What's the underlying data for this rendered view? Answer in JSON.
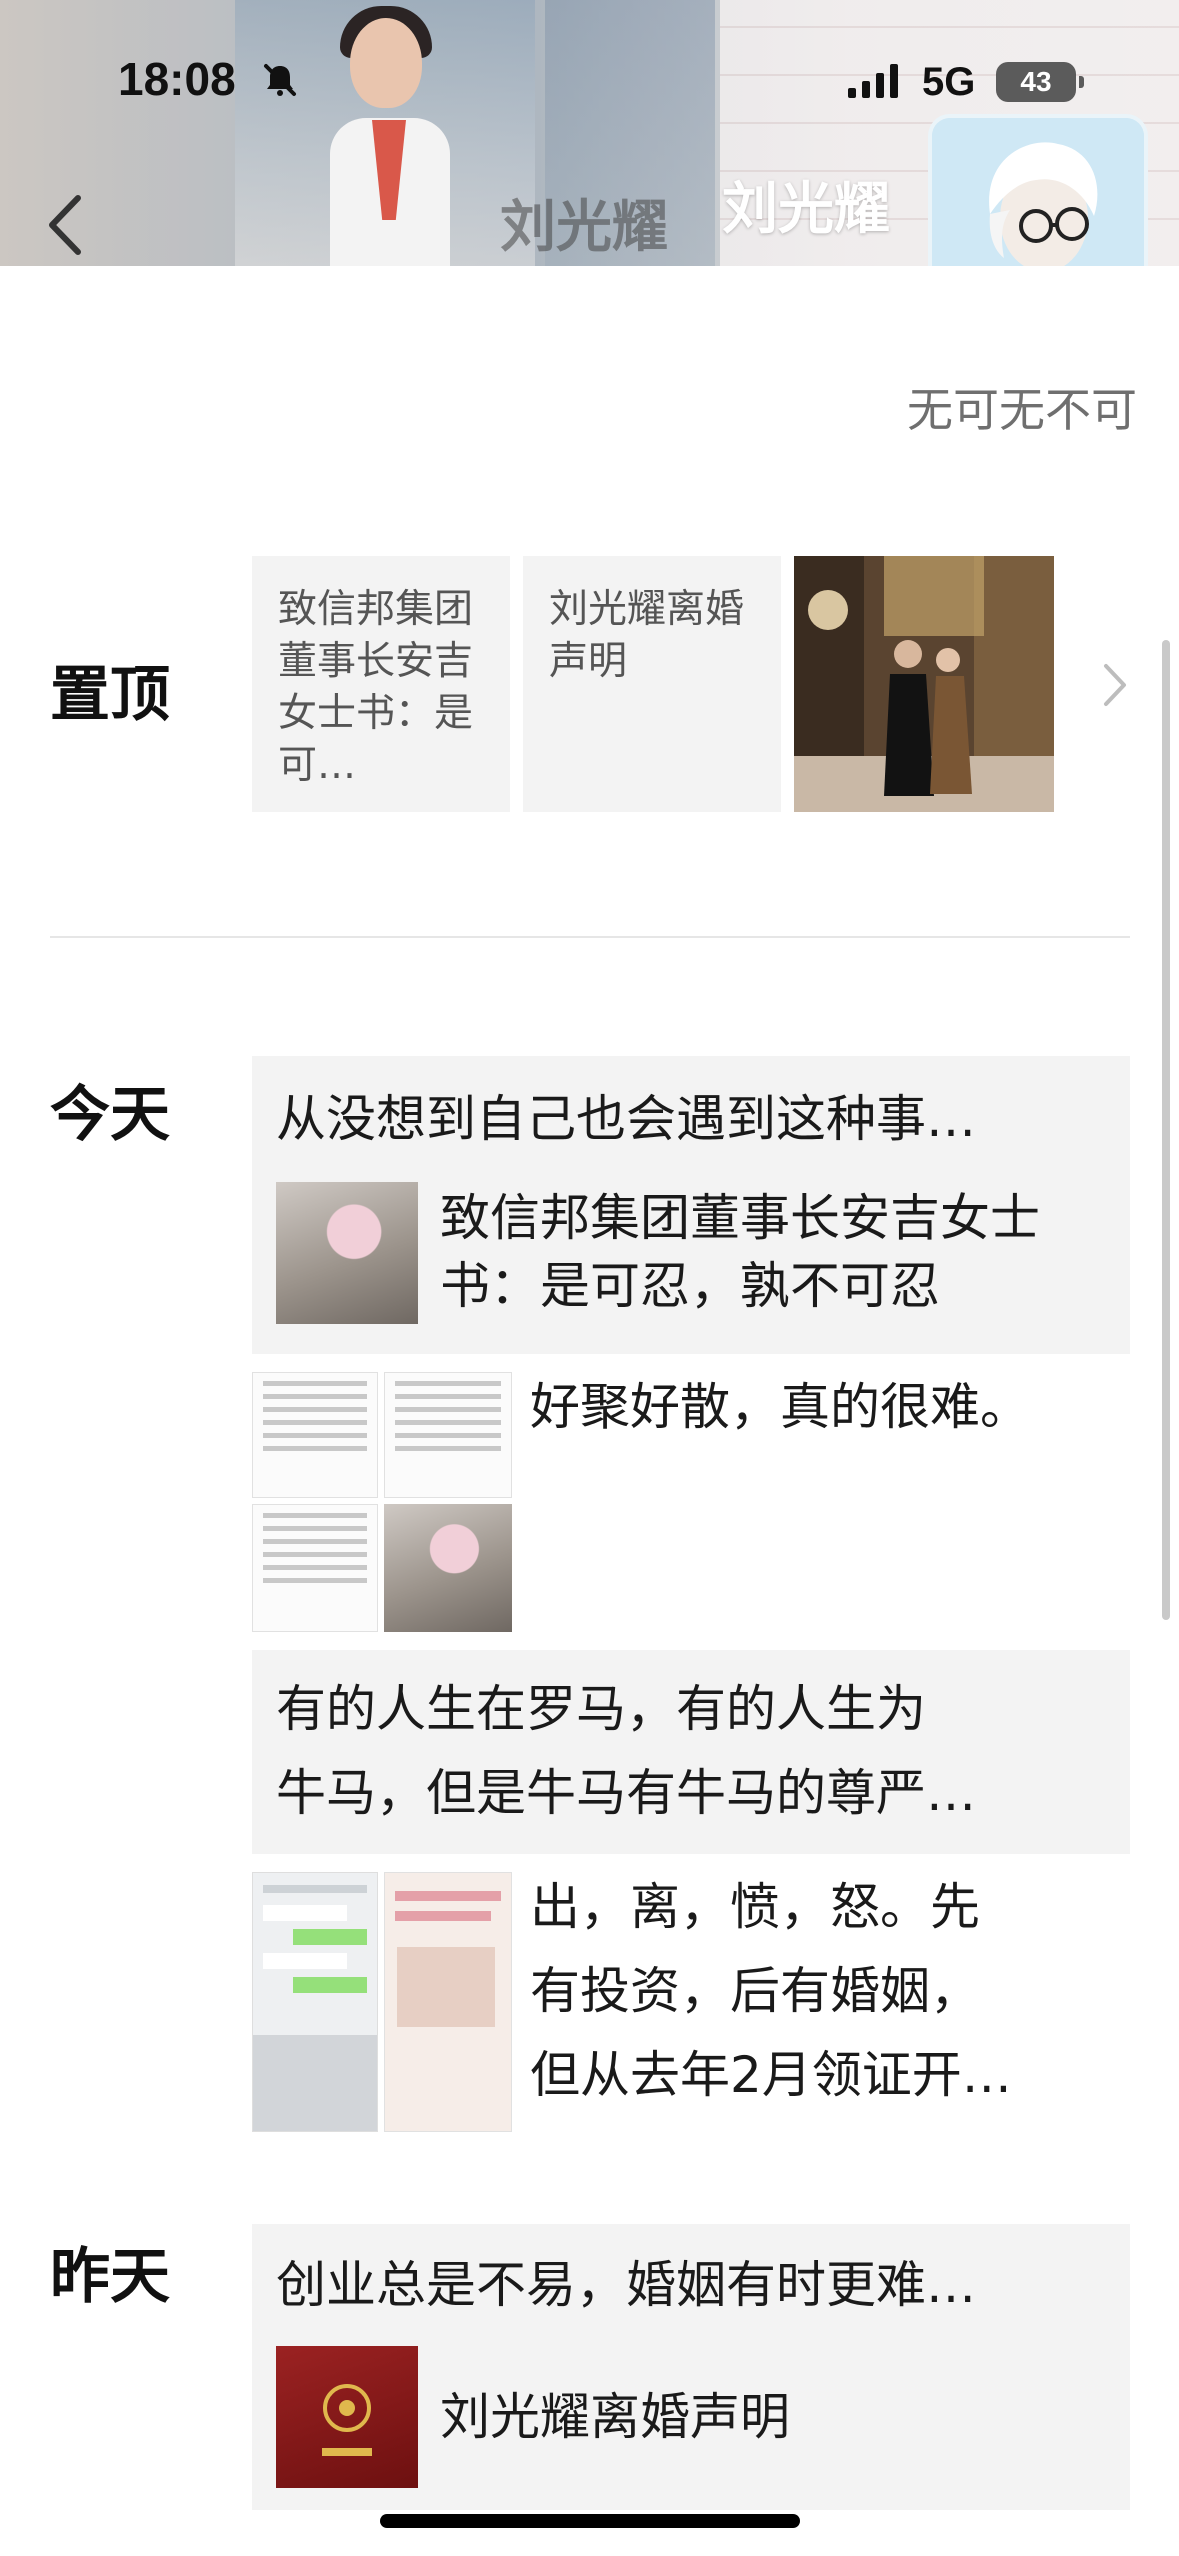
{
  "status_bar": {
    "time": "18:08",
    "network": "5G",
    "battery": "43"
  },
  "header": {
    "profile_name": "刘光耀",
    "cover_name_ghost": "刘光耀"
  },
  "profile": {
    "signature": "无可无不可"
  },
  "pinned": {
    "label": "置顶",
    "cards": [
      {
        "text": "致信邦集团董事长安吉女士书：是可…"
      },
      {
        "text": "刘光耀离婚声明"
      }
    ]
  },
  "today": {
    "label": "今天",
    "posts": [
      {
        "text": "从没想到自己也会遇到这种事…",
        "link_title": "致信邦集团董事长安吉女士书：是可忍，孰不可忍"
      },
      {
        "text": "好聚好散，真的很难。"
      },
      {
        "text": "有的人生在罗马，有的人生为牛马，但是牛马有牛马的尊严…",
        "line1": "有的人生在罗马，有的人生为",
        "line2": "牛马，但是牛马有牛马的尊严…"
      },
      {
        "line1": "出，离，愤，怒。先",
        "line2": "有投资，后有婚姻，",
        "line3": "但从去年2月领证开…"
      }
    ]
  },
  "yesterday": {
    "label": "昨天",
    "posts": [
      {
        "text": "创业总是不易，婚姻有时更难…",
        "link_title": "刘光耀离婚声明"
      }
    ]
  },
  "colors": {
    "card_bg": "#f3f3f3",
    "secondary_text": "#6f6f6f",
    "divider": "#e6e6e6"
  }
}
